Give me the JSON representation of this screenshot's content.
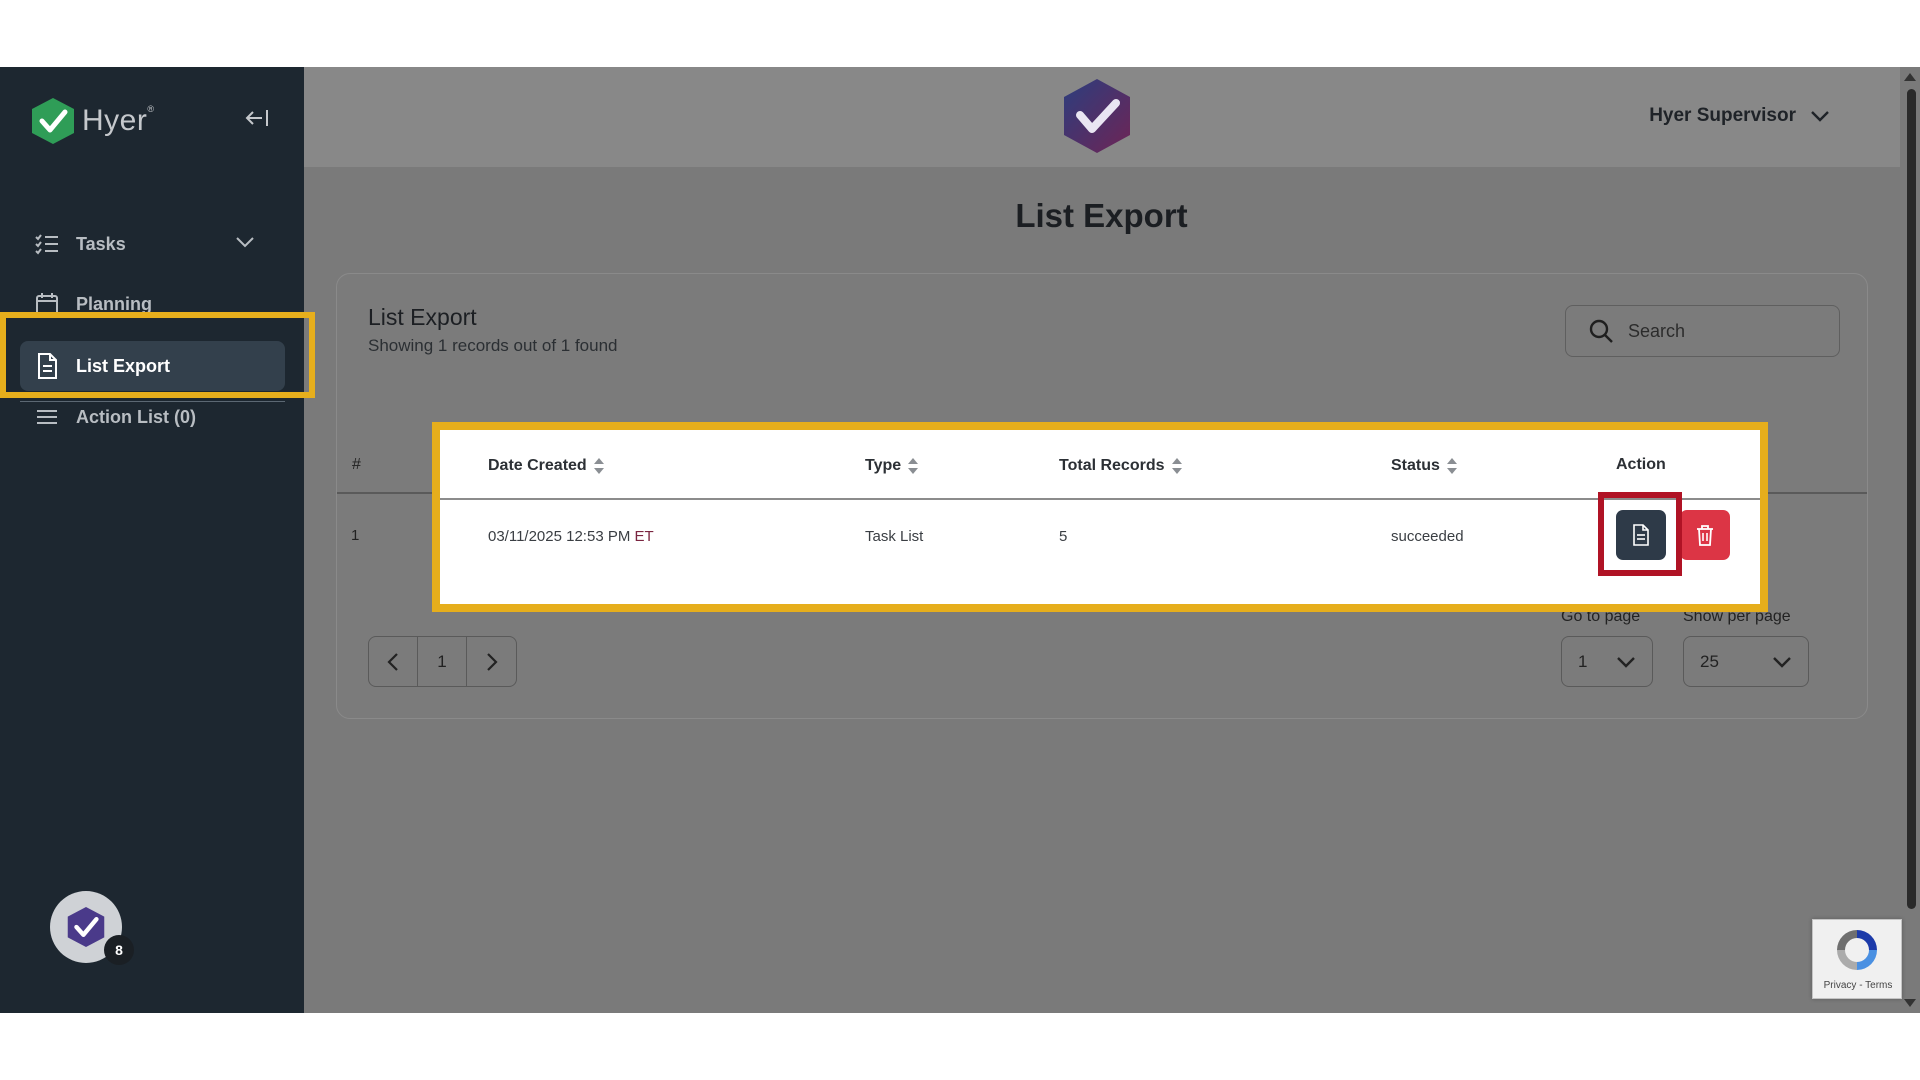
{
  "app": {
    "logo_text": "Hyer"
  },
  "sidebar": {
    "items": [
      {
        "label": "Tasks"
      },
      {
        "label": "Planning"
      },
      {
        "label": "List Export"
      },
      {
        "label": "Action List (0)"
      }
    ],
    "notification_count": "8"
  },
  "header": {
    "user_name": "Hyer Supervisor"
  },
  "page": {
    "title": "List Export"
  },
  "card": {
    "title": "List Export",
    "subtitle": "Showing 1 records out of 1 found",
    "search_placeholder": "Search"
  },
  "table": {
    "index_header": "#",
    "columns": [
      "Date Created",
      "Type",
      "Total Records",
      "Status",
      "Action"
    ],
    "rows": [
      {
        "index": "1",
        "date": "03/11/2025 12:53 PM",
        "timezone": "ET",
        "type": "Task List",
        "total": "5",
        "status": "succeeded"
      }
    ]
  },
  "pagination": {
    "current_page": "1",
    "goto_label": "Go to page",
    "goto_value": "1",
    "per_page_label": "Show per page",
    "per_page_value": "25"
  },
  "recaptcha": {
    "links": "Privacy - Terms"
  },
  "colors": {
    "highlight_yellow": "#e6ae1c",
    "highlight_red": "#b01325",
    "sidebar_bg": "#1d2730",
    "delete_red": "#dc3545",
    "download_dark": "#2e3a48"
  }
}
